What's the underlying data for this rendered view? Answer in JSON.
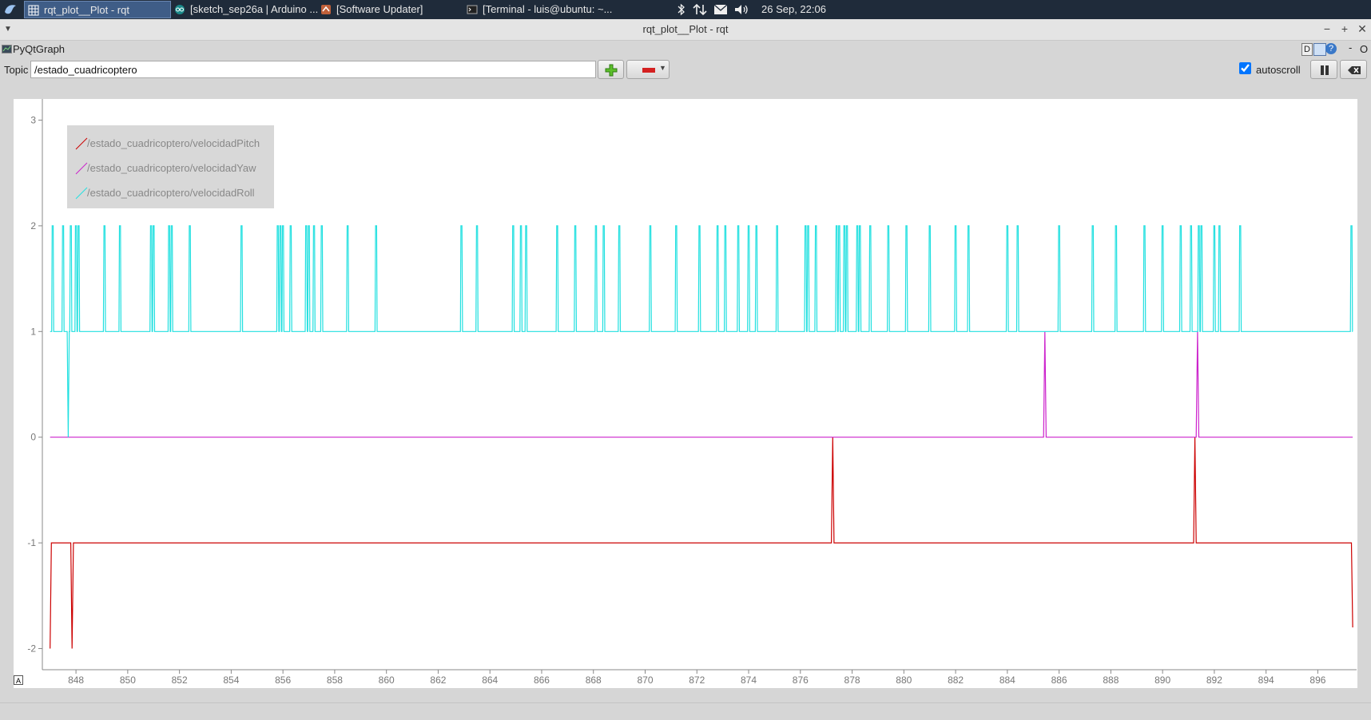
{
  "taskbar": {
    "tasks": [
      {
        "label": "rqt_plot__Plot - rqt",
        "icon": "grid-icon"
      },
      {
        "label": "[sketch_sep26a | Arduino ...",
        "icon": "arduino-icon"
      },
      {
        "label": "[Software Updater]",
        "icon": "updater-icon"
      },
      {
        "label": "[Terminal - luis@ubuntu: ~...",
        "icon": "terminal-icon"
      }
    ],
    "clock": "26 Sep, 22:06"
  },
  "window": {
    "title": "rqt_plot__Plot - rqt"
  },
  "plugin": {
    "name": "PyQtGraph",
    "help_badges": [
      "D",
      "?",
      "-",
      "O"
    ]
  },
  "toolbar": {
    "topic_label": "Topic",
    "topic_value": "/estado_cuadricoptero",
    "autoscroll_label": "autoscroll",
    "autoscroll_checked": true
  },
  "colors": {
    "pitch": "#cc0000",
    "yaw": "#cc22cc",
    "roll": "#22e0e0",
    "axis": "#888888"
  },
  "chart_data": {
    "type": "line",
    "xlim": [
      846.7,
      897.5
    ],
    "ylim": [
      -2.2,
      3.2
    ],
    "xticks": [
      "848",
      "850",
      "852",
      "854",
      "856",
      "858",
      "860",
      "862",
      "864",
      "866",
      "868",
      "870",
      "872",
      "874",
      "876",
      "878",
      "880",
      "882",
      "884",
      "886",
      "888",
      "890",
      "892",
      "894",
      "896"
    ],
    "yticks": [
      "3",
      "2",
      "1",
      "0",
      "-1",
      "-2"
    ],
    "legend_position": "top-left",
    "grid": false,
    "series": [
      {
        "name": "/estado_cuadricoptero/velocidadPitch",
        "color": "#cc0000",
        "points": [
          [
            847.0,
            -2
          ],
          [
            847.05,
            -1
          ],
          [
            847.8,
            -1
          ],
          [
            847.85,
            -2
          ],
          [
            847.9,
            -1
          ],
          [
            877.2,
            -1
          ],
          [
            877.25,
            0
          ],
          [
            877.3,
            -1
          ],
          [
            891.2,
            -1
          ],
          [
            891.25,
            0
          ],
          [
            891.3,
            -1
          ],
          [
            897.3,
            -1
          ],
          [
            897.35,
            -1.8
          ]
        ]
      },
      {
        "name": "/estado_cuadricoptero/velocidadYaw",
        "color": "#cc22cc",
        "points": [
          [
            847.0,
            0
          ],
          [
            885.4,
            0
          ],
          [
            885.45,
            1
          ],
          [
            885.5,
            0
          ],
          [
            891.3,
            0
          ],
          [
            891.35,
            1
          ],
          [
            891.4,
            0
          ],
          [
            897.35,
            0
          ]
        ]
      },
      {
        "name": "/estado_cuadricoptero/velocidadRoll",
        "color": "#22e0e0",
        "base": 1,
        "high": 2,
        "dip": [
          847.7,
          0
        ],
        "spikes": [
          847.1,
          847.5,
          847.8,
          848.0,
          848.1,
          849.1,
          849.7,
          850.9,
          851.0,
          851.6,
          851.7,
          852.4,
          854.4,
          855.8,
          855.9,
          856.0,
          856.3,
          856.9,
          857.0,
          857.2,
          857.5,
          858.5,
          859.6,
          862.9,
          863.5,
          864.9,
          865.2,
          865.4,
          866.6,
          867.3,
          868.1,
          868.4,
          869.0,
          870.2,
          871.2,
          872.1,
          872.8,
          873.1,
          873.6,
          874.0,
          874.3,
          875.1,
          876.2,
          876.3,
          876.6,
          877.4,
          877.5,
          877.7,
          877.8,
          878.2,
          878.3,
          878.7,
          879.4,
          880.1,
          881.0,
          882.0,
          882.5,
          884.0,
          884.4,
          886.0,
          887.3,
          888.2,
          889.3,
          890.0,
          890.7,
          891.1,
          891.4,
          891.5,
          892.0,
          892.2,
          893.0,
          897.3
        ]
      }
    ]
  }
}
